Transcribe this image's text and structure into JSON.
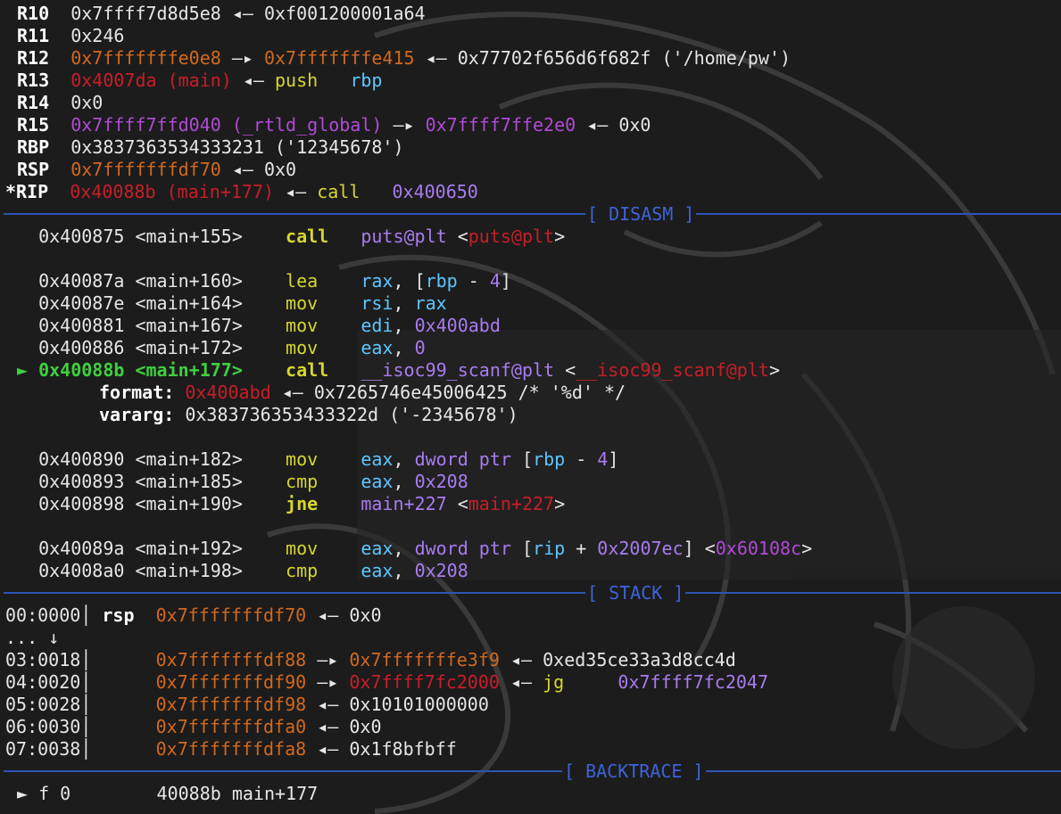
{
  "registers": [
    {
      "name": "R10",
      "parts": [
        {
          "t": "0x7ffff7d8d5e8",
          "c": "w"
        },
        {
          "t": " ◂— ",
          "c": "arrow"
        },
        {
          "t": "0xf001200001a64",
          "c": "w"
        }
      ]
    },
    {
      "name": "R11",
      "parts": [
        {
          "t": "0x246",
          "c": "w"
        }
      ]
    },
    {
      "name": "R12",
      "parts": [
        {
          "t": "0x7fffffffe0e8",
          "c": "orange"
        },
        {
          "t": " —▸ ",
          "c": "arrow"
        },
        {
          "t": "0x7fffffffe415",
          "c": "orange"
        },
        {
          "t": " ◂— ",
          "c": "arrow"
        },
        {
          "t": "0x77702f656d6f682f ('/home/pw')",
          "c": "w"
        }
      ]
    },
    {
      "name": "R13",
      "parts": [
        {
          "t": "0x4007da (main)",
          "c": "red"
        },
        {
          "t": " ◂— ",
          "c": "arrow"
        },
        {
          "t": "push",
          "c": "yellow"
        },
        {
          "t": "   ",
          "c": "w"
        },
        {
          "t": "rbp",
          "c": "cyan"
        }
      ]
    },
    {
      "name": "R14",
      "parts": [
        {
          "t": "0x0",
          "c": "w"
        }
      ]
    },
    {
      "name": "R15",
      "parts": [
        {
          "t": "0x7ffff7ffd040 (_rtld_global)",
          "c": "purple"
        },
        {
          "t": " —▸ ",
          "c": "arrow"
        },
        {
          "t": "0x7ffff7ffe2e0",
          "c": "purple"
        },
        {
          "t": " ◂— ",
          "c": "arrow"
        },
        {
          "t": "0x0",
          "c": "w"
        }
      ]
    },
    {
      "name": "RBP",
      "parts": [
        {
          "t": "0x3837363534333231 ('12345678')",
          "c": "w"
        }
      ]
    },
    {
      "name": "RSP",
      "parts": [
        {
          "t": "0x7fffffffdf70",
          "c": "orange"
        },
        {
          "t": " ◂— ",
          "c": "arrow"
        },
        {
          "t": "0x0",
          "c": "w"
        }
      ]
    },
    {
      "name": "*RIP",
      "parts": [
        {
          "t": "0x40088b (main+177)",
          "c": "red"
        },
        {
          "t": " ◂— ",
          "c": "arrow"
        },
        {
          "t": "call",
          "c": "yellow"
        },
        {
          "t": "   ",
          "c": "w"
        },
        {
          "t": "0x400650",
          "c": "lpurple"
        }
      ]
    }
  ],
  "headers": {
    "disasm": "[ DISASM ]",
    "stack": "[ STACK ]",
    "backtrace": "[ BACKTRACE ]"
  },
  "disasm": [
    {
      "marker": "",
      "addr": "0x400875 <main+155>",
      "op": "call",
      "opbold": true,
      "args": [
        {
          "t": "puts@plt",
          "c": "lpurple"
        },
        {
          "t": " <",
          "c": "w"
        },
        {
          "t": "puts@plt",
          "c": "red"
        },
        {
          "t": ">",
          "c": "w"
        }
      ]
    },
    {
      "blank": true
    },
    {
      "marker": "",
      "addr": "0x40087a <main+160>",
      "op": "lea",
      "args": [
        {
          "t": "rax",
          "c": "cyan"
        },
        {
          "t": ", [",
          "c": "w"
        },
        {
          "t": "rbp",
          "c": "cyan"
        },
        {
          "t": " - ",
          "c": "w"
        },
        {
          "t": "4",
          "c": "lpurple"
        },
        {
          "t": "]",
          "c": "w"
        }
      ]
    },
    {
      "marker": "",
      "addr": "0x40087e <main+164>",
      "op": "mov",
      "args": [
        {
          "t": "rsi",
          "c": "cyan"
        },
        {
          "t": ", ",
          "c": "w"
        },
        {
          "t": "rax",
          "c": "cyan"
        }
      ]
    },
    {
      "marker": "",
      "addr": "0x400881 <main+167>",
      "op": "mov",
      "args": [
        {
          "t": "edi",
          "c": "cyan"
        },
        {
          "t": ", ",
          "c": "w"
        },
        {
          "t": "0x400abd",
          "c": "lpurple"
        }
      ]
    },
    {
      "marker": "",
      "addr": "0x400886 <main+172>",
      "op": "mov",
      "args": [
        {
          "t": "eax",
          "c": "cyan"
        },
        {
          "t": ", ",
          "c": "w"
        },
        {
          "t": "0",
          "c": "lpurple"
        }
      ]
    },
    {
      "marker": "►",
      "current": true,
      "addr": "0x40088b <main+177>",
      "op": "call",
      "opbold": true,
      "args": [
        {
          "t": "__isoc99_scanf@plt",
          "c": "lpurple"
        },
        {
          "t": " <",
          "c": "w"
        },
        {
          "t": "__isoc99_scanf@plt",
          "c": "red"
        },
        {
          "t": ">",
          "c": "w"
        }
      ]
    },
    {
      "argline": true,
      "label": "format:",
      "parts": [
        {
          "t": "0x400abd",
          "c": "red"
        },
        {
          "t": " ◂— ",
          "c": "arrow"
        },
        {
          "t": "0x7265746e45006425 /* '%d' */",
          "c": "w"
        }
      ]
    },
    {
      "argline": true,
      "label": "vararg:",
      "parts": [
        {
          "t": "0x383736353433322d ('-2345678')",
          "c": "w"
        }
      ]
    },
    {
      "blank": true
    },
    {
      "marker": "",
      "addr": "0x400890 <main+182>",
      "op": "mov",
      "args": [
        {
          "t": "eax",
          "c": "cyan"
        },
        {
          "t": ", ",
          "c": "w"
        },
        {
          "t": "dword ptr",
          "c": "lpurple"
        },
        {
          "t": " [",
          "c": "w"
        },
        {
          "t": "rbp",
          "c": "cyan"
        },
        {
          "t": " - ",
          "c": "w"
        },
        {
          "t": "4",
          "c": "lpurple"
        },
        {
          "t": "]",
          "c": "w"
        }
      ]
    },
    {
      "marker": "",
      "addr": "0x400893 <main+185>",
      "op": "cmp",
      "args": [
        {
          "t": "eax",
          "c": "cyan"
        },
        {
          "t": ", ",
          "c": "w"
        },
        {
          "t": "0x208",
          "c": "lpurple"
        }
      ]
    },
    {
      "marker": "",
      "addr": "0x400898 <main+190>",
      "op": "jne",
      "opbold": true,
      "args": [
        {
          "t": "main+227",
          "c": "lpurple"
        },
        {
          "t": " <",
          "c": "w"
        },
        {
          "t": "main+227",
          "c": "red"
        },
        {
          "t": ">",
          "c": "w"
        }
      ]
    },
    {
      "blank": true
    },
    {
      "marker": "",
      "addr": "0x40089a <main+192>",
      "op": "mov",
      "args": [
        {
          "t": "eax",
          "c": "cyan"
        },
        {
          "t": ", ",
          "c": "w"
        },
        {
          "t": "dword ptr",
          "c": "lpurple"
        },
        {
          "t": " [",
          "c": "w"
        },
        {
          "t": "rip",
          "c": "cyan"
        },
        {
          "t": " + ",
          "c": "w"
        },
        {
          "t": "0x2007ec",
          "c": "lpurple"
        },
        {
          "t": "] <",
          "c": "w"
        },
        {
          "t": "0x60108c",
          "c": "purple"
        },
        {
          "t": ">",
          "c": "w"
        }
      ]
    },
    {
      "marker": "",
      "addr": "0x4008a0 <main+198>",
      "op": "cmp",
      "args": [
        {
          "t": "eax",
          "c": "cyan"
        },
        {
          "t": ", ",
          "c": "w"
        },
        {
          "t": "0x208",
          "c": "lpurple"
        }
      ]
    }
  ],
  "stack": [
    {
      "idx": "00:0000",
      "reg": "rsp",
      "parts": [
        {
          "t": "0x7fffffffdf70",
          "c": "orange"
        },
        {
          "t": " ◂— ",
          "c": "arrow"
        },
        {
          "t": "0x0",
          "c": "w"
        }
      ]
    },
    {
      "skip": "... ↓"
    },
    {
      "idx": "03:0018",
      "reg": "",
      "parts": [
        {
          "t": "0x7fffffffdf88",
          "c": "orange"
        },
        {
          "t": " —▸ ",
          "c": "arrow"
        },
        {
          "t": "0x7fffffffe3f9",
          "c": "orange"
        },
        {
          "t": " ◂— ",
          "c": "arrow"
        },
        {
          "t": "0xed35ce33a3d8cc4d",
          "c": "w"
        }
      ]
    },
    {
      "idx": "04:0020",
      "reg": "",
      "parts": [
        {
          "t": "0x7fffffffdf90",
          "c": "orange"
        },
        {
          "t": " —▸ ",
          "c": "arrow"
        },
        {
          "t": "0x7ffff7fc2000",
          "c": "red"
        },
        {
          "t": " ◂— ",
          "c": "arrow"
        },
        {
          "t": "jg",
          "c": "yellow"
        },
        {
          "t": "     ",
          "c": "w"
        },
        {
          "t": "0x7ffff7fc2047",
          "c": "lpurple"
        }
      ]
    },
    {
      "idx": "05:0028",
      "reg": "",
      "parts": [
        {
          "t": "0x7fffffffdf98",
          "c": "orange"
        },
        {
          "t": " ◂— ",
          "c": "arrow"
        },
        {
          "t": "0x10101000000",
          "c": "w"
        }
      ]
    },
    {
      "idx": "06:0030",
      "reg": "",
      "parts": [
        {
          "t": "0x7fffffffdfa0",
          "c": "orange"
        },
        {
          "t": " ◂— ",
          "c": "arrow"
        },
        {
          "t": "0x0",
          "c": "w"
        }
      ]
    },
    {
      "idx": "07:0038",
      "reg": "",
      "parts": [
        {
          "t": "0x7fffffffdfa8",
          "c": "orange"
        },
        {
          "t": " ◂— ",
          "c": "arrow"
        },
        {
          "t": "0x1f8bfbff",
          "c": "w"
        }
      ]
    }
  ],
  "backtrace": [
    {
      "marker": "►",
      "frame": "f 0",
      "addr": "40088b",
      "sym": "main+177"
    }
  ]
}
